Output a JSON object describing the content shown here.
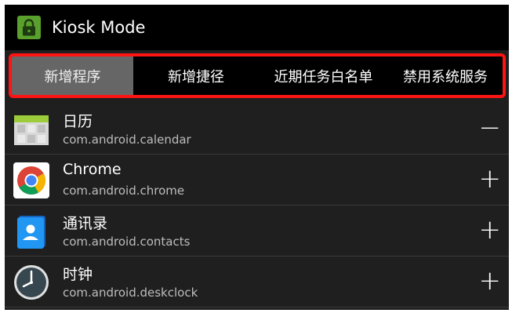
{
  "app": {
    "title": "Kiosk Mode",
    "icon": "lock-icon",
    "accent": "#5aa02c"
  },
  "tabs": [
    {
      "label": "新增程序",
      "active": true
    },
    {
      "label": "新增捷径",
      "active": false
    },
    {
      "label": "近期任务白名单",
      "active": false
    },
    {
      "label": "禁用系统服务",
      "active": false
    }
  ],
  "highlight_color": "#ff1414",
  "apps": [
    {
      "name": "日历",
      "package": "com.android.calendar",
      "action": "−",
      "icon": "calendar-icon"
    },
    {
      "name": "Chrome",
      "package": "com.android.chrome",
      "action": "+",
      "icon": "chrome-icon"
    },
    {
      "name": "通讯录",
      "package": "com.android.contacts",
      "action": "+",
      "icon": "contacts-icon"
    },
    {
      "name": "时钟",
      "package": "com.android.deskclock",
      "action": "+",
      "icon": "clock-icon"
    }
  ]
}
